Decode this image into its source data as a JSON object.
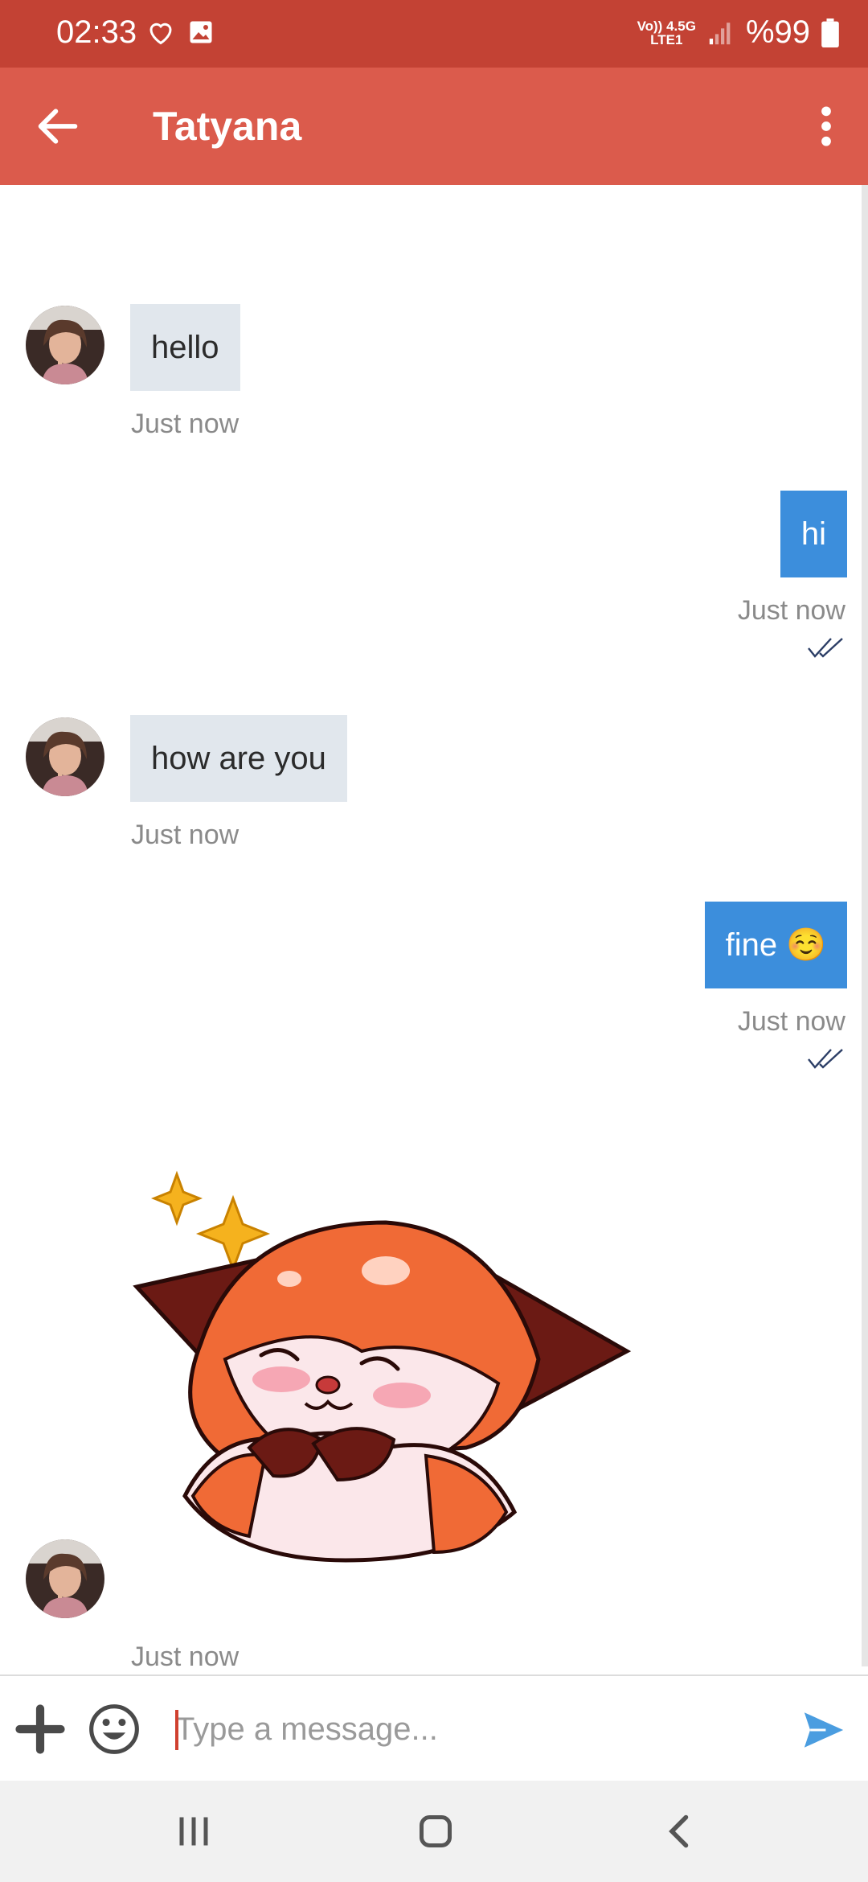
{
  "status_bar": {
    "time": "02:33",
    "network_top": "Vo)) 4.5G",
    "network_bottom": "LTE1",
    "battery": "%99"
  },
  "header": {
    "title": "Tatyana"
  },
  "messages": [
    {
      "direction": "incoming",
      "text": "hello",
      "time": "Just now"
    },
    {
      "direction": "outgoing",
      "text": "hi",
      "time": "Just now",
      "status": "read"
    },
    {
      "direction": "incoming",
      "text": "how are you",
      "time": "Just now"
    },
    {
      "direction": "outgoing",
      "text": "fine ☺️",
      "time": "Just now",
      "status": "read"
    },
    {
      "direction": "incoming",
      "type": "sticker",
      "sticker": "fox-sticker",
      "time": "Just now"
    }
  ],
  "composer": {
    "placeholder": "Type a message..."
  },
  "colors": {
    "status_bar": "#c34234",
    "app_bar": "#db5b4c",
    "incoming_bubble": "#e1e7ed",
    "outgoing_bubble": "#3c8edc"
  },
  "icons": {
    "back": "arrow-left-icon",
    "more": "more-vertical-icon",
    "attach": "plus-icon",
    "emoji": "emoji-icon",
    "send": "send-icon",
    "read": "double-check-icon"
  }
}
